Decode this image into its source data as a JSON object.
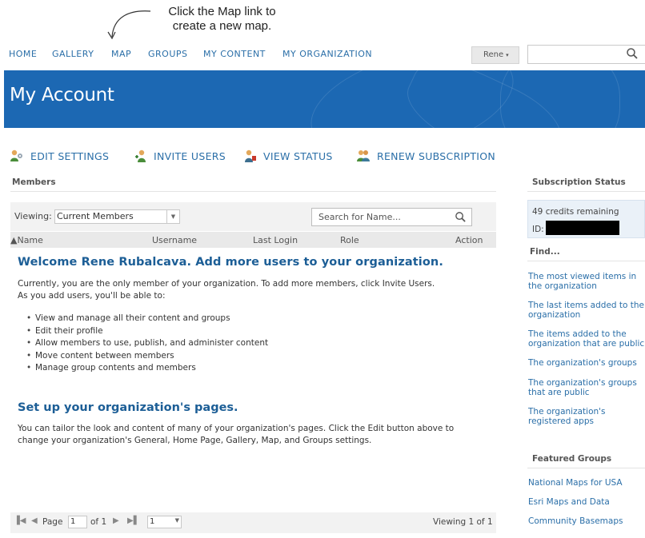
{
  "annotation": {
    "line1": "Click the Map link to",
    "line2": "create a new map."
  },
  "nav": {
    "home": "HOME",
    "gallery": "GALLERY",
    "map": "MAP",
    "groups": "GROUPS",
    "my_content": "MY CONTENT",
    "my_organization": "MY ORGANIZATION",
    "user": "Rene",
    "user_caret": "▾"
  },
  "banner": {
    "title": "My Account",
    "color": "#1c68b3"
  },
  "toolbar": {
    "edit_settings": "EDIT SETTINGS",
    "invite_users": "INVITE USERS",
    "view_status": "VIEW STATUS",
    "renew_subscription": "RENEW SUBSCRIPTION"
  },
  "members": {
    "title": "Members",
    "viewing_label": "Viewing:",
    "viewing_value": "Current Members",
    "search_placeholder": "Search for Name...",
    "columns": {
      "name": "▲Name",
      "username": "Username",
      "last_login": "Last Login",
      "role": "Role",
      "action": "Action"
    },
    "welcome_heading": "Welcome Rene Rubalcava. Add more users to your organization.",
    "intro_line1": "Currently, you are the only member of your organization. To add more members, click Invite Users.",
    "intro_line2": "As you add users, you'll be able to:",
    "bullets": [
      "View and manage all their content and groups",
      "Edit their profile",
      "Allow members to use, publish, and administer content",
      "Move content between members",
      "Manage group contents and members"
    ],
    "setup_heading": "Set up your organization's pages.",
    "setup_line1": "You can tailor the look and content of many of your organization's pages. Click the Edit button above to",
    "setup_line2": "change your organization's General, Home Page, Gallery, Map, and Groups settings."
  },
  "pager": {
    "page_label": "Page",
    "page_value": "1",
    "of_label": "of 1",
    "size_value": "1",
    "viewing": "Viewing 1 of 1"
  },
  "sidebar": {
    "subscription_title": "Subscription Status",
    "credits": "49 credits remaining",
    "id_label": "ID:",
    "find_title": "Find...",
    "find_links": [
      [
        "The most viewed items in",
        "the organization"
      ],
      [
        "The last items added to the",
        "organization"
      ],
      [
        "The items added to the",
        "organization that are public"
      ],
      [
        "The organization's groups",
        ""
      ],
      [
        "The organization's groups",
        "that are public"
      ],
      [
        "The organization's",
        "registered apps"
      ]
    ],
    "featured_title": "Featured Groups",
    "featured_links": [
      "National Maps for USA",
      "Esri Maps and Data",
      "Community Basemaps"
    ]
  }
}
